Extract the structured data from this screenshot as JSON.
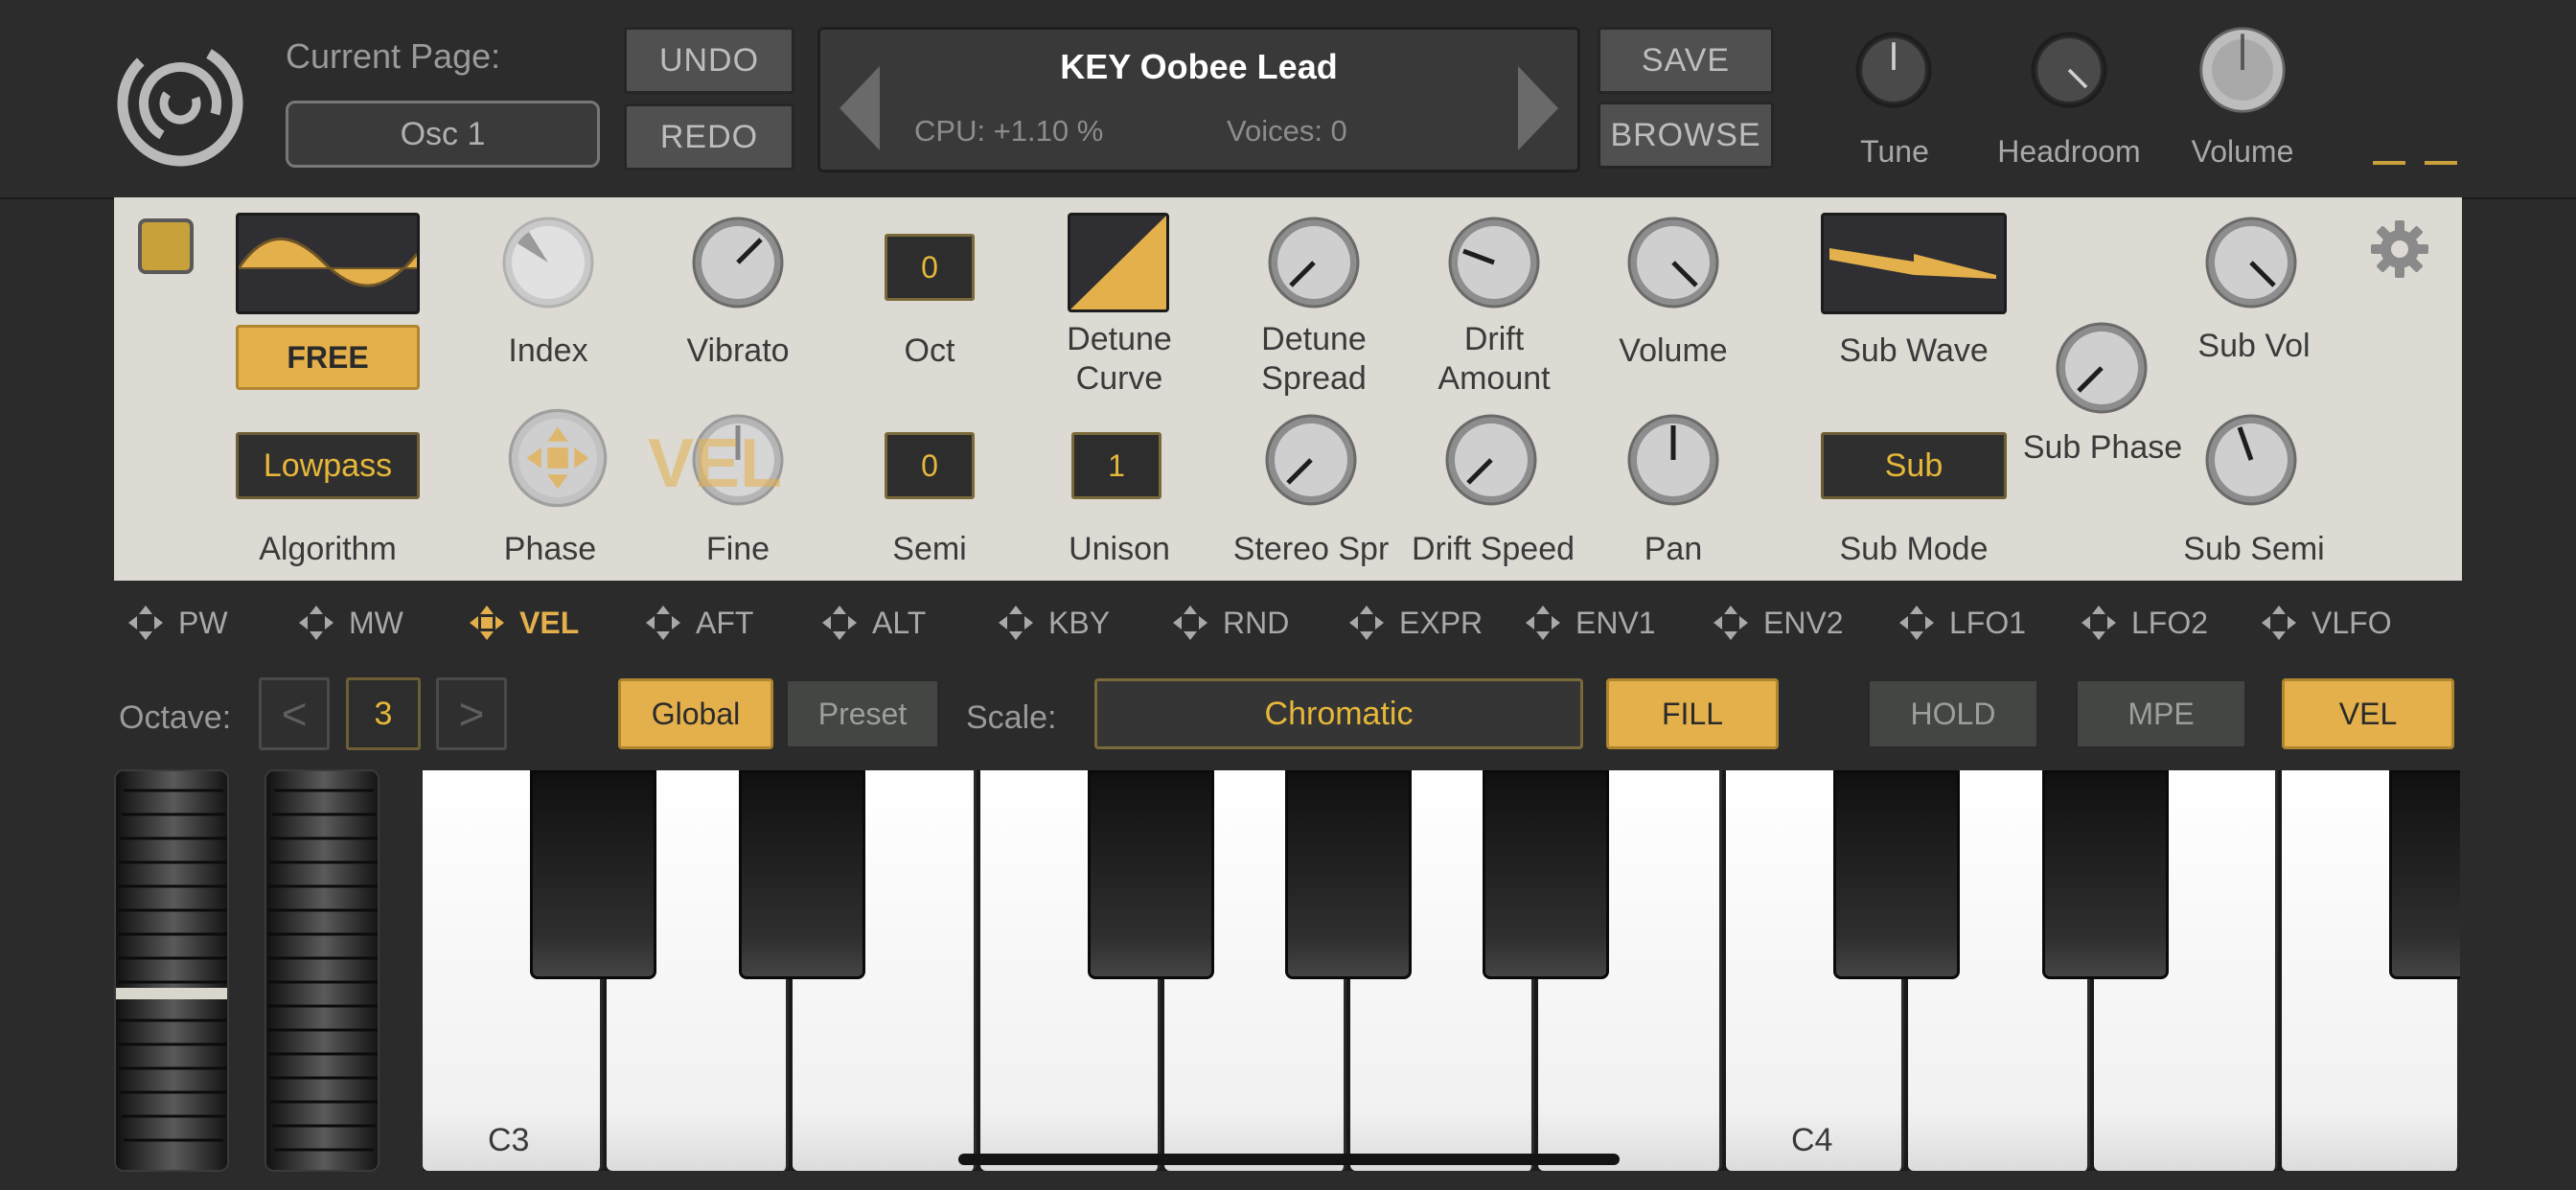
{
  "header": {
    "current_page_label": "Current Page:",
    "current_page_value": "Osc 1",
    "undo": "UNDO",
    "redo": "REDO",
    "save": "SAVE",
    "browse": "BROWSE",
    "preset_name": "KEY Oobee Lead",
    "cpu": "CPU: +1.10 %",
    "voices": "Voices: 0",
    "knobs": [
      {
        "label": "Tune"
      },
      {
        "label": "Headroom"
      },
      {
        "label": "Volume"
      }
    ]
  },
  "panel": {
    "free_label": "FREE",
    "algorithm_value": "Lowpass",
    "labels": {
      "index": "Index",
      "vibrato": "Vibrato",
      "oct": "Oct",
      "detune_curve_1": "Detune",
      "detune_curve_2": "Curve",
      "detune_spread_1": "Detune",
      "detune_spread_2": "Spread",
      "drift_amount_1": "Drift",
      "drift_amount_2": "Amount",
      "volume": "Volume",
      "sub_wave": "Sub Wave",
      "sub_vol": "Sub Vol",
      "sub_phase": "Sub Phase",
      "algorithm": "Algorithm",
      "phase": "Phase",
      "fine": "Fine",
      "semi": "Semi",
      "unison": "Unison",
      "stereo_spr": "Stereo Spr",
      "drift_speed": "Drift Speed",
      "pan": "Pan",
      "sub_mode": "Sub Mode",
      "sub_semi": "Sub Semi"
    },
    "values": {
      "oct": "0",
      "semi": "0",
      "unison": "1",
      "sub_mode": "Sub"
    },
    "vel_overlay": "VEL"
  },
  "mod_sources": [
    {
      "label": "PW",
      "active": false
    },
    {
      "label": "MW",
      "active": false
    },
    {
      "label": "VEL",
      "active": true
    },
    {
      "label": "AFT",
      "active": false
    },
    {
      "label": "ALT",
      "active": false
    },
    {
      "label": "KBY",
      "active": false
    },
    {
      "label": "RND",
      "active": false
    },
    {
      "label": "EXPR",
      "active": false
    },
    {
      "label": "ENV1",
      "active": false
    },
    {
      "label": "ENV2",
      "active": false
    },
    {
      "label": "LFO1",
      "active": false
    },
    {
      "label": "LFO2",
      "active": false
    },
    {
      "label": "VLFO",
      "active": false
    }
  ],
  "controls": {
    "octave_label": "Octave:",
    "octave_value": "3",
    "prev": "<",
    "next": ">",
    "global": "Global",
    "preset": "Preset",
    "scale_label": "Scale:",
    "scale_value": "Chromatic",
    "fill": "FILL",
    "hold": "HOLD",
    "mpe": "MPE",
    "vel": "VEL"
  },
  "keyboard": {
    "labels": [
      "C3",
      "C4"
    ]
  },
  "colors": {
    "accent": "#e3b04b",
    "panel_bg": "#dcdad3",
    "app_bg": "#2b2b2b"
  }
}
